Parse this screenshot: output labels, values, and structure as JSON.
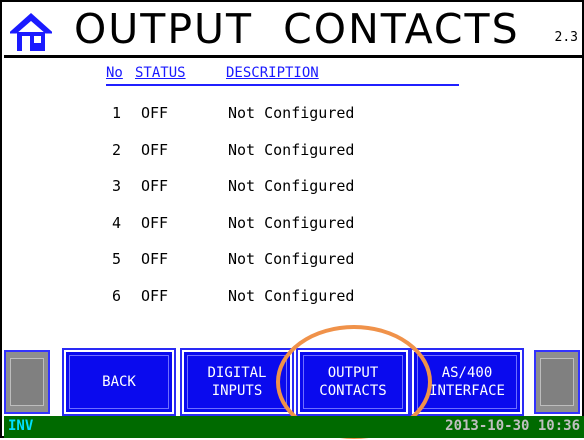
{
  "header": {
    "title": "OUTPUT  CONTACTS",
    "page_number": "2.3",
    "home_icon": "home-icon"
  },
  "table": {
    "columns": [
      "No",
      "STATUS",
      "DESCRIPTION"
    ],
    "rows": [
      {
        "no": "1",
        "status": "OFF",
        "description": "Not Configured"
      },
      {
        "no": "2",
        "status": "OFF",
        "description": "Not Configured"
      },
      {
        "no": "3",
        "status": "OFF",
        "description": "Not Configured"
      },
      {
        "no": "4",
        "status": "OFF",
        "description": "Not Configured"
      },
      {
        "no": "5",
        "status": "OFF",
        "description": "Not Configured"
      },
      {
        "no": "6",
        "status": "OFF",
        "description": "Not Configured"
      }
    ]
  },
  "buttons": {
    "back": "BACK",
    "digital_line1": "DIGITAL",
    "digital_line2": "INPUTS",
    "output_line1": "OUTPUT",
    "output_line2": "CONTACTS",
    "as400_line1": "AS/400",
    "as400_line2": "INTERFACE"
  },
  "status_bar": {
    "left": "INV",
    "datetime": "2013-10-30 10:36"
  },
  "colors": {
    "button_blue": "#0a0aee",
    "header_column_blue": "#1a1aff",
    "status_green": "#006a00",
    "highlight_orange": "#f0924a"
  }
}
